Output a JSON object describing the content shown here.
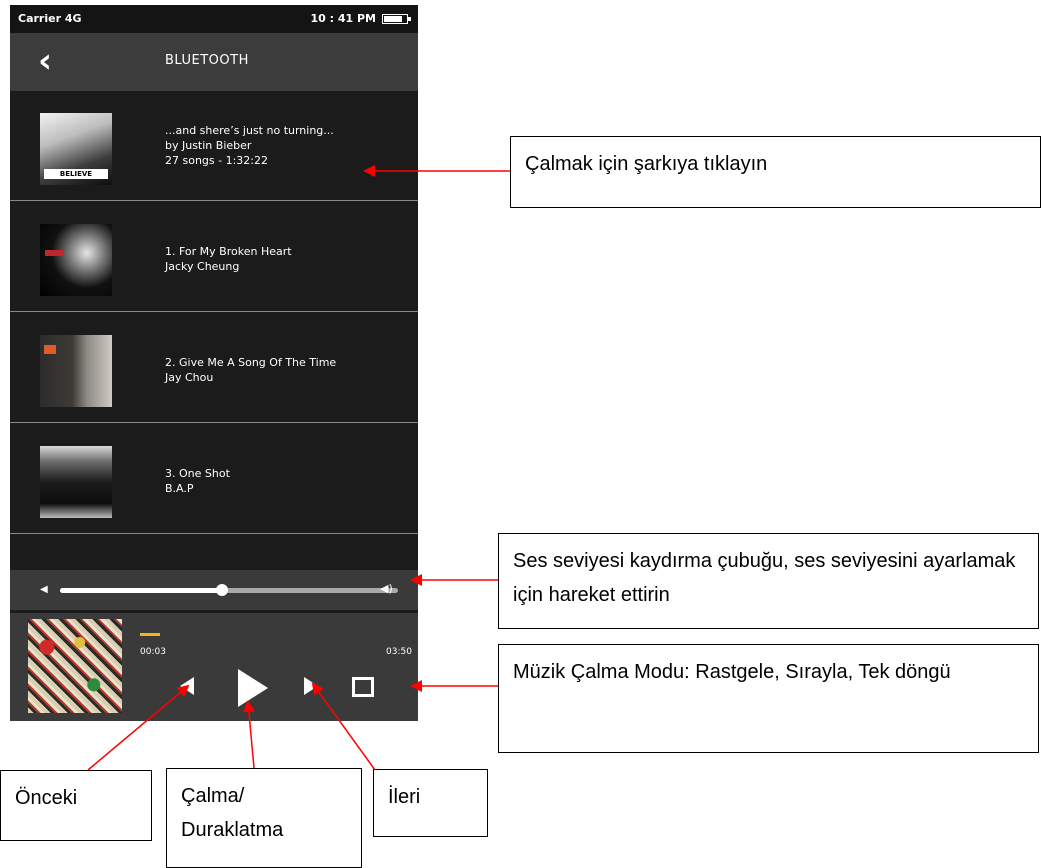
{
  "status_bar": {
    "carrier": "Carrier 4G",
    "time": "10 : 41 PM"
  },
  "header": {
    "back_icon": "chevron-left-icon",
    "title": "BLUETOOTH"
  },
  "songs": [
    {
      "line1": "...and shere’s just no turning...",
      "line2": "by Justin Bieber",
      "line3": "27 songs - 1:32:22",
      "cover_text": "BELIEVE"
    },
    {
      "line1": "1. For My Broken Heart",
      "line2": "Jacky Cheung"
    },
    {
      "line1": "2. Give Me A Song Of The Time",
      "line2": "Jay Chou"
    },
    {
      "line1": "3. One Shot",
      "line2": "B.A.P"
    }
  ],
  "volume": {
    "level_percent": 48,
    "low_icon": "volume-low-icon",
    "high_icon": "volume-high-icon"
  },
  "player": {
    "current_time": "00:03",
    "total_time": "03:50",
    "progress_color": "#f2b321"
  },
  "callouts": {
    "click_song": "Çalmak için şarkıya tıklayın",
    "volume": "Ses seviyesi kaydırma çubuğu, ses seviyesini ayarlamak için hareket ettirin",
    "mode": "Müzik Çalma Modu: Rastgele, Sırayla, Tek döngü",
    "previous": "Önceki",
    "play_pause": "Çalma/ Duraklatma",
    "next": "İleri"
  },
  "colors": {
    "annotation_arrow": "#ff0000"
  }
}
